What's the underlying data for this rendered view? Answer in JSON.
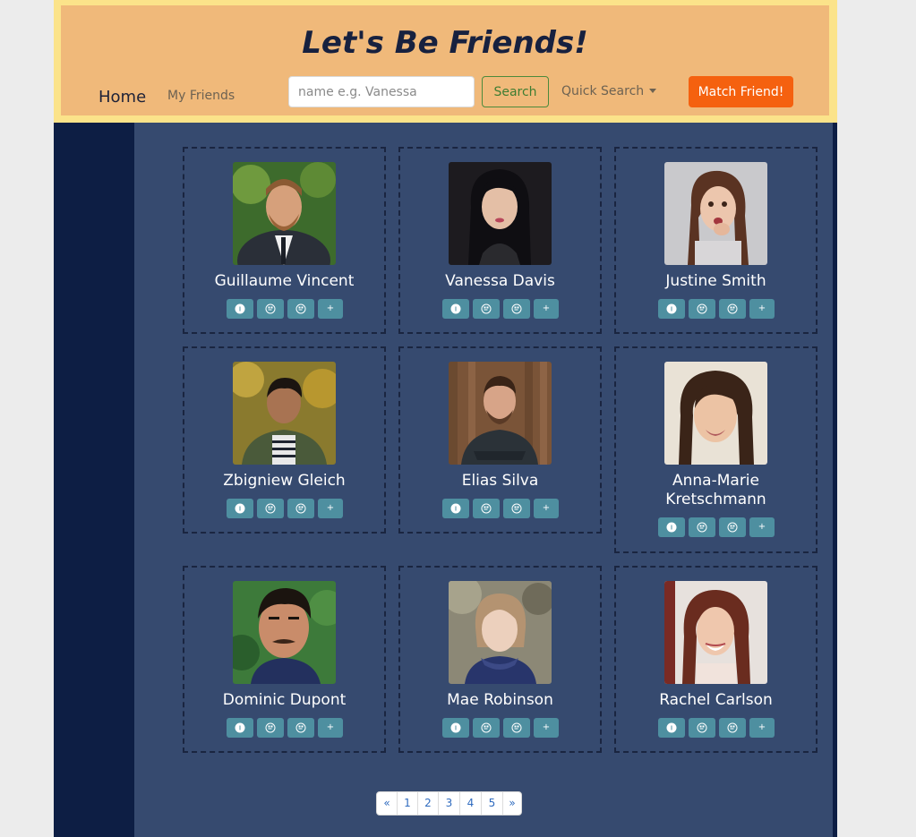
{
  "header": {
    "title": "Let's Be Friends!",
    "nav_home": "Home",
    "nav_friends": "My Friends",
    "search_placeholder": "name e.g. Vanessa",
    "search_button": "Search",
    "quick_search": "Quick Search",
    "match_button": "Match Friend!"
  },
  "colors": {
    "header_bg": "#f0b97a",
    "header_border": "#fbe38a",
    "page_bg": "#364a6f",
    "sidebar_bg": "#0d1e44",
    "accent_button": "#f5610f",
    "action_button": "#4e8fa0"
  },
  "friends": [
    {
      "name": "Guillaume Vincent",
      "actions": [
        "info-icon",
        "smile-icon",
        "frown-icon",
        "plus-icon"
      ]
    },
    {
      "name": "Vanessa Davis",
      "actions": [
        "info-icon",
        "smile-icon",
        "frown-icon",
        "plus-icon"
      ]
    },
    {
      "name": "Justine Smith",
      "actions": [
        "info-icon",
        "smile-icon",
        "frown-icon",
        "plus-icon"
      ]
    },
    {
      "name": "Zbigniew Gleich",
      "actions": [
        "info-icon",
        "smile-icon",
        "frown-icon",
        "plus-icon"
      ]
    },
    {
      "name": "Elias Silva",
      "actions": [
        "info-icon",
        "smile-icon",
        "frown-icon",
        "plus-icon"
      ]
    },
    {
      "name": "Anna-Marie Kretschmann",
      "actions": [
        "info-icon",
        "smile-icon",
        "frown-icon",
        "plus-icon"
      ]
    },
    {
      "name": "Dominic Dupont",
      "actions": [
        "info-icon",
        "smile-icon",
        "frown-icon",
        "plus-icon"
      ]
    },
    {
      "name": "Mae Robinson",
      "actions": [
        "info-icon",
        "smile-icon",
        "frown-icon",
        "plus-icon"
      ]
    },
    {
      "name": "Rachel Carlson",
      "actions": [
        "info-icon",
        "smile-icon",
        "frown-icon",
        "plus-icon"
      ]
    }
  ],
  "pagination": {
    "prev": "«",
    "pages": [
      "1",
      "2",
      "3",
      "4",
      "5"
    ],
    "next": "»"
  }
}
